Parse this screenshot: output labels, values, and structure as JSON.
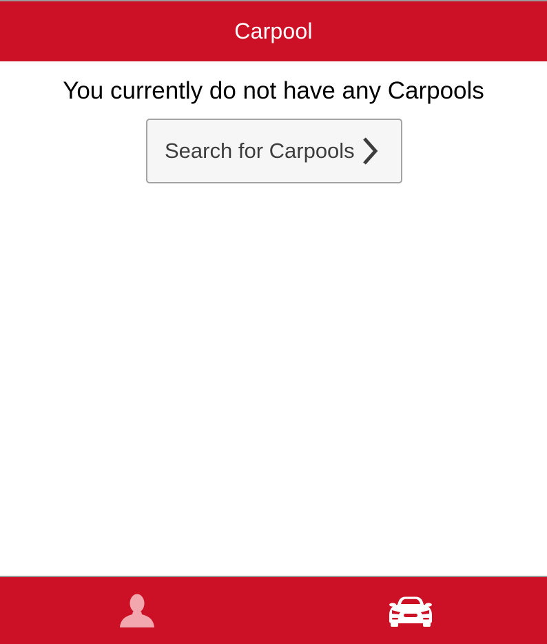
{
  "header": {
    "title": "Carpool"
  },
  "main": {
    "empty_message": "You currently do not have any Carpools",
    "search_button_label": "Search for Carpools",
    "search_button_icon": "chevron-right-icon"
  },
  "tabbar": {
    "tabs": [
      {
        "icon": "person-icon",
        "active": false
      },
      {
        "icon": "car-icon",
        "active": true
      }
    ]
  },
  "colors": {
    "brand": "#cc1126",
    "inactive_icon": "#f2a6ae",
    "active_icon": "#ffffff",
    "button_text": "#3d3d3d",
    "button_background": "#f6f6f6"
  }
}
